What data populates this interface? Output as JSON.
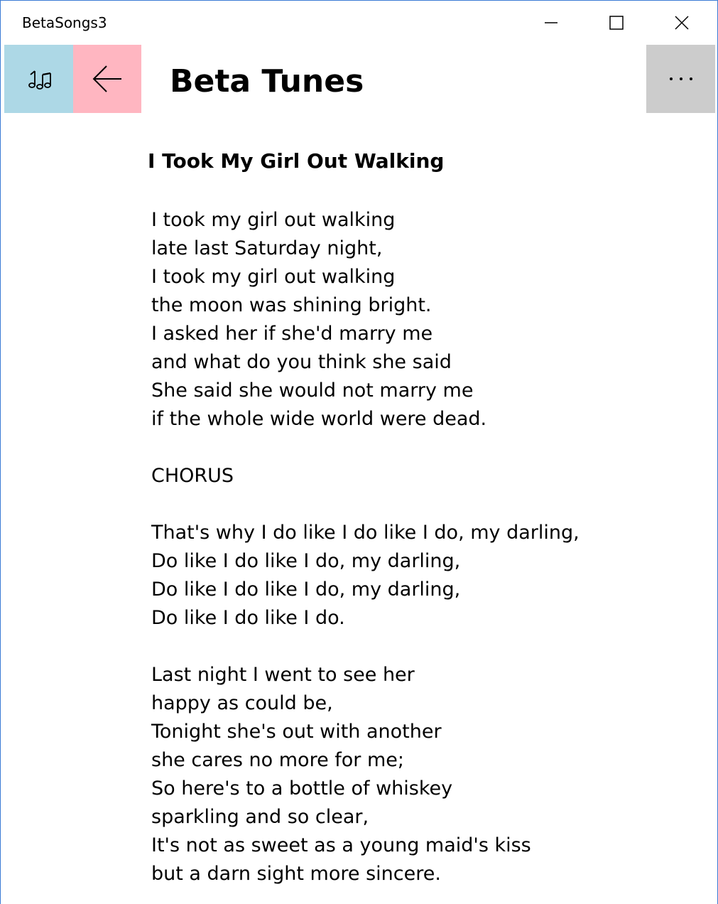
{
  "window": {
    "app_title": "BetaSongs3"
  },
  "header": {
    "title": "Beta Tunes"
  },
  "song": {
    "title": "I Took My Girl Out Walking",
    "lines": [
      "I took my girl out walking",
      "late last Saturday night,",
      "I took my girl out walking",
      "the moon was shining bright.",
      "I asked her if she'd marry me",
      "and what do you think she said",
      "She said she would not marry me",
      "if the whole wide world were dead.",
      "",
      "CHORUS",
      "",
      "That's why I do like I do like I do, my darling,",
      "Do like I do like I do, my darling,",
      "Do like I do like I do, my darling,",
      "Do like I do like I do.",
      "",
      "Last night I went to see her",
      "happy as could be,",
      "Tonight she's out with another",
      "she cares no more for me;",
      "So here's to a bottle of whiskey",
      "sparkling and so clear,",
      "It's not as sweet as a young maid's kiss",
      "but a darn sight more sincere."
    ]
  },
  "colors": {
    "music_button": "#add8e6",
    "back_button": "#ffb6c1",
    "more_button": "#cccccc",
    "window_border": "#3a7bd5"
  },
  "icons": {
    "music": "music-notes-icon",
    "back": "arrow-left-icon",
    "more": "more-dots-icon",
    "minimize": "minimize-icon",
    "maximize": "maximize-icon",
    "close": "close-icon"
  }
}
